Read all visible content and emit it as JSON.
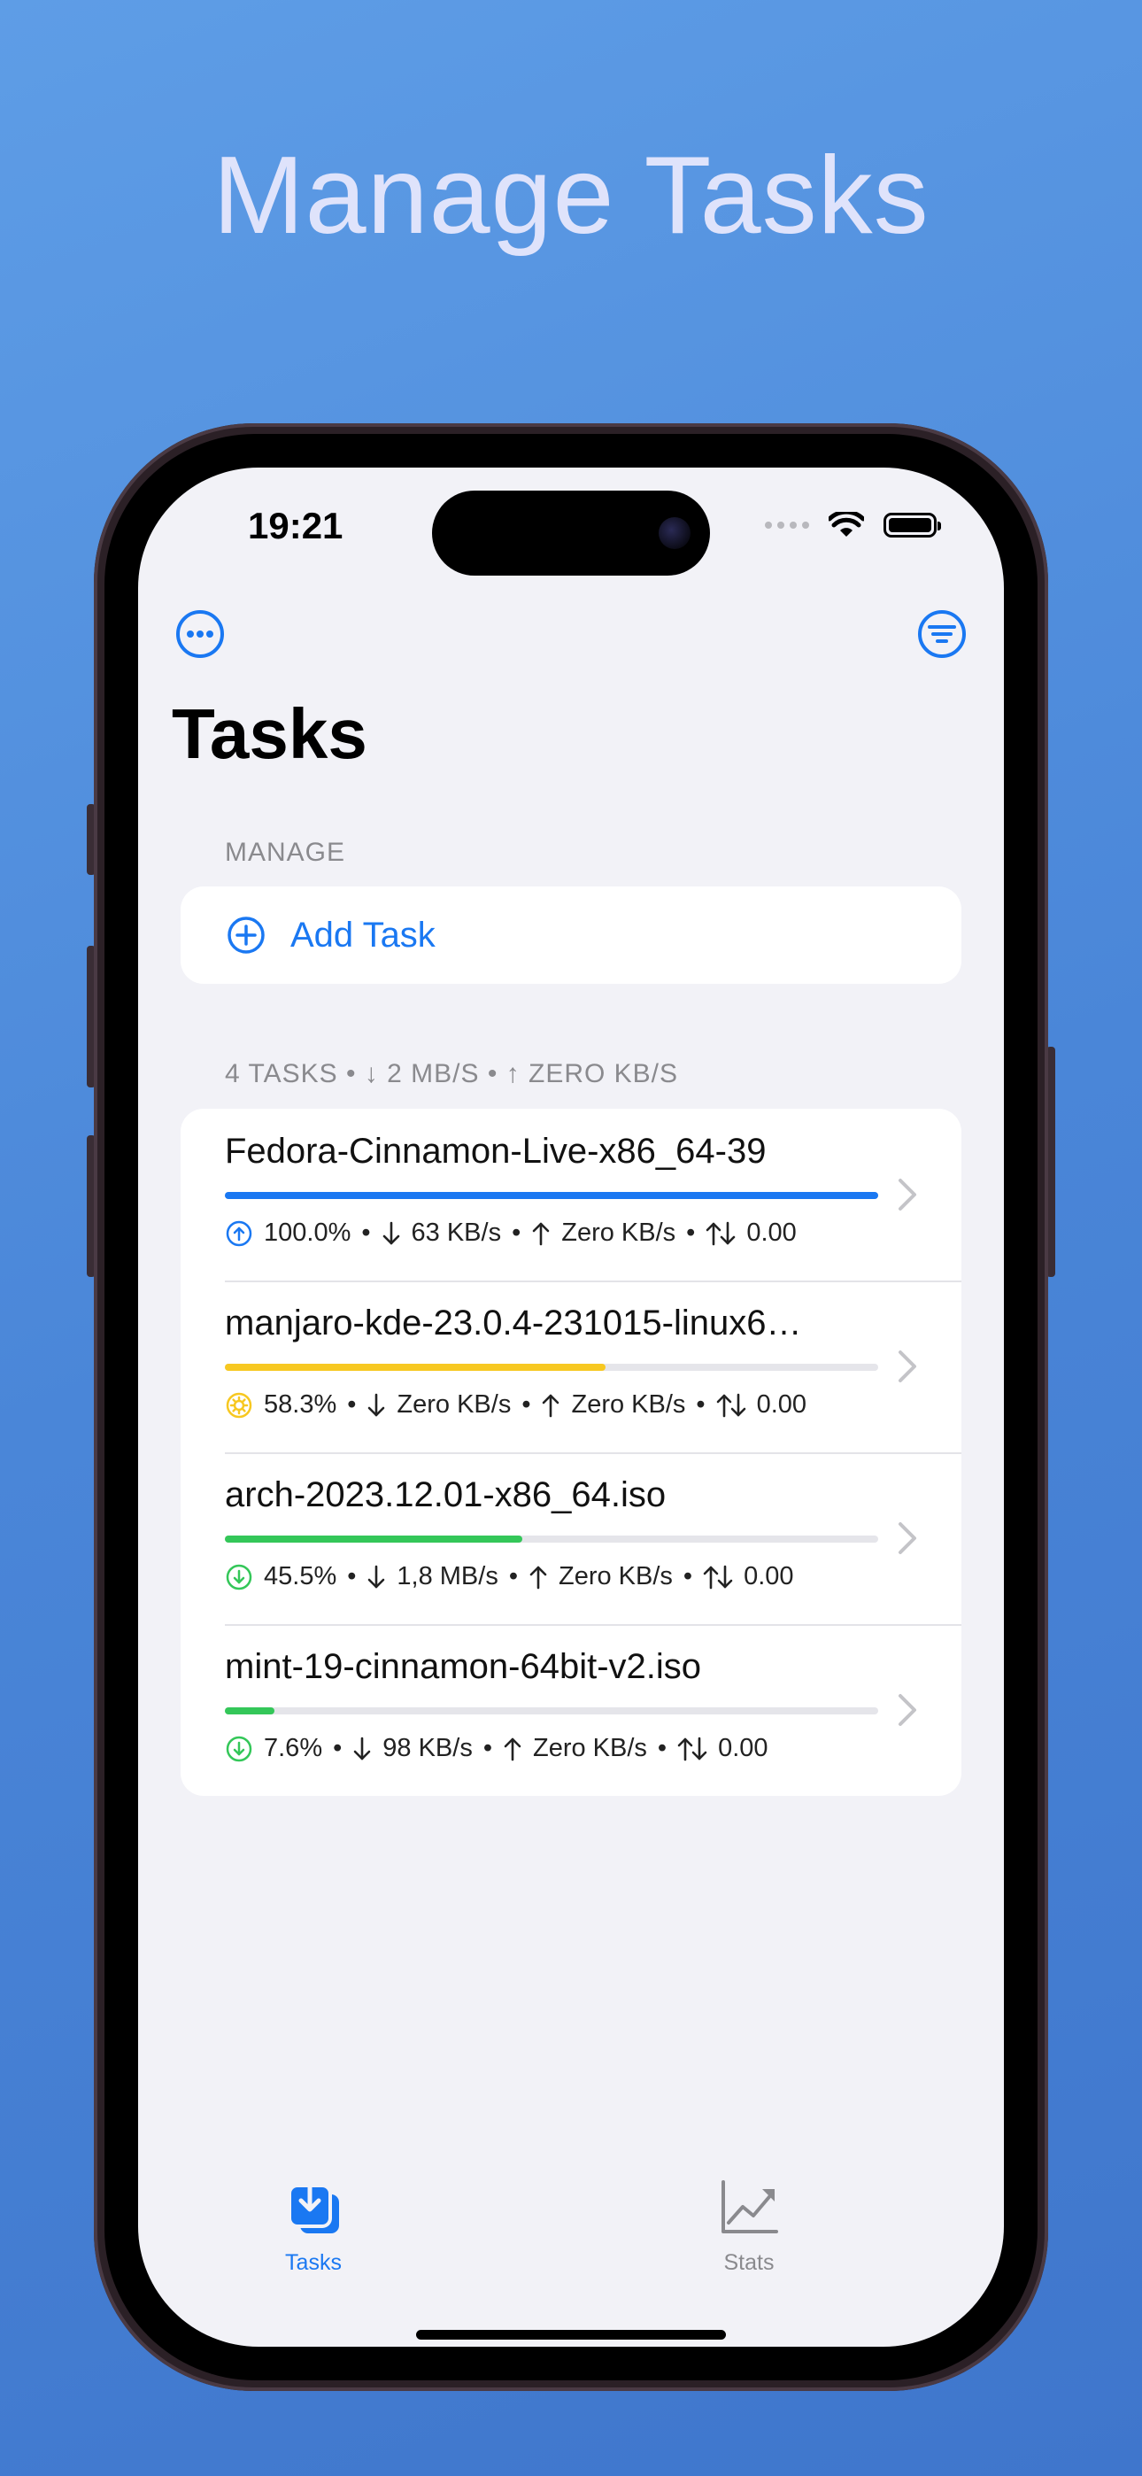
{
  "headline": "Manage Tasks",
  "status_bar": {
    "time": "19:21"
  },
  "nav": {
    "title": "Tasks"
  },
  "manage_section": {
    "header": "MANAGE",
    "add_task_label": "Add Task"
  },
  "tasks_section": {
    "header": "4 TASKS • ↓ 2 MB/S • ↑ ZERO KB/S",
    "tasks": [
      {
        "name": "Fedora-Cinnamon-Live-x86_64-39",
        "progress": 1.0,
        "status": "seeding",
        "color": "#1a78f2",
        "percent": "100.0%",
        "down": "63 KB/s",
        "up": "Zero KB/s",
        "ratio": "0.00"
      },
      {
        "name": "manjaro-kde-23.0.4-231015-linux6…",
        "progress": 0.583,
        "status": "checking",
        "color": "#f7c821",
        "percent": "58.3%",
        "down": "Zero KB/s",
        "up": "Zero KB/s",
        "ratio": "0.00"
      },
      {
        "name": "arch-2023.12.01-x86_64.iso",
        "progress": 0.455,
        "status": "downloading",
        "color": "#34c759",
        "percent": "45.5%",
        "down": "1,8 MB/s",
        "up": "Zero KB/s",
        "ratio": "0.00"
      },
      {
        "name": "mint-19-cinnamon-64bit-v2.iso",
        "progress": 0.076,
        "status": "downloading",
        "color": "#34c759",
        "percent": "7.6%",
        "down": "98 KB/s",
        "up": "Zero KB/s",
        "ratio": "0.00"
      }
    ]
  },
  "tab_bar": {
    "tabs": [
      {
        "label": "Tasks",
        "icon": "tasks-download-icon",
        "active": true
      },
      {
        "label": "Stats",
        "icon": "chart-icon",
        "active": false
      }
    ]
  },
  "colors": {
    "accent": "#1a78f2",
    "inactive": "#8a8a8e"
  }
}
